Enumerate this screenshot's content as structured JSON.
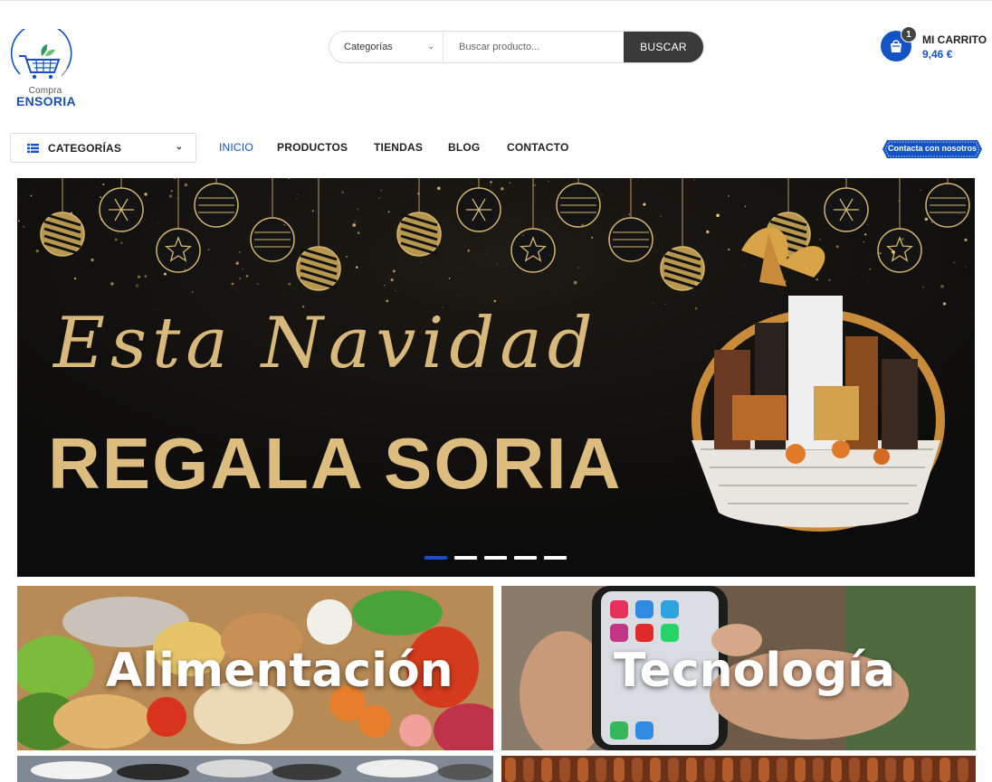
{
  "logo": {
    "line1": "Compra",
    "line2": "ENSORIA"
  },
  "search": {
    "category_label": "Categorías",
    "placeholder": "Buscar producto...",
    "button_label": "BUSCAR"
  },
  "cart": {
    "badge": "1",
    "title": "MI CARRITO",
    "total": "9,46 €"
  },
  "nav": {
    "categories_label": "CATEGORÍAS",
    "links": [
      "INICIO",
      "PRODUCTOS",
      "TIENDAS",
      "BLOG",
      "CONTACTO"
    ],
    "contact_label": "Contacta con nosotros"
  },
  "hero": {
    "script_text": "Esta Navidad",
    "bold_text": "REGALA SORIA",
    "slides": 5,
    "active_slide": 1
  },
  "tiles": [
    "Alimentación",
    "Tecnología"
  ],
  "colors": {
    "accent": "#1453c4",
    "gold": "#d9b97b",
    "dark": "#3a3a3a"
  }
}
